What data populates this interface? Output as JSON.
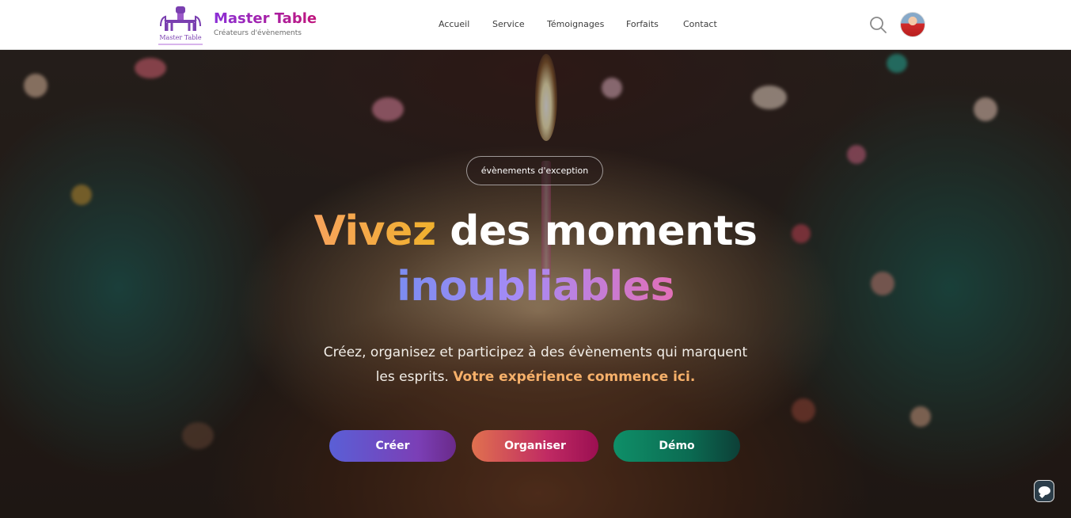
{
  "header": {
    "brand_name": "Master Table",
    "brand_tagline": "Créateurs d'évènements",
    "logo_text": "Master Table",
    "nav": [
      {
        "label": "Accueil"
      },
      {
        "label": "Service"
      },
      {
        "label": "Témoignages"
      },
      {
        "label": "Forfaits"
      },
      {
        "label": "Contact"
      }
    ],
    "search_icon": "search-icon",
    "avatar_icon": "user-avatar"
  },
  "hero": {
    "badge": "évènements d'exception",
    "headline_accent": "Vivez",
    "headline_rest": "des moments",
    "headline_line2": "inoubliables",
    "subtitle": "Créez, organisez et participez à des évènements qui marquent les esprits.",
    "subtitle_accent": "Votre expérience commence ici.",
    "buttons": {
      "create": "Créer",
      "organize": "Organiser",
      "demo": "Démo"
    }
  },
  "chat_icon": "chat-bubble-icon",
  "colors": {
    "brand_purple": "#8b2fd6",
    "brand_pink": "#c0157c",
    "accent_orange": "#f6b06a",
    "create_btn": "#5a5fd6",
    "organize_btn": "#c02a63",
    "demo_btn": "#0f8f68"
  }
}
